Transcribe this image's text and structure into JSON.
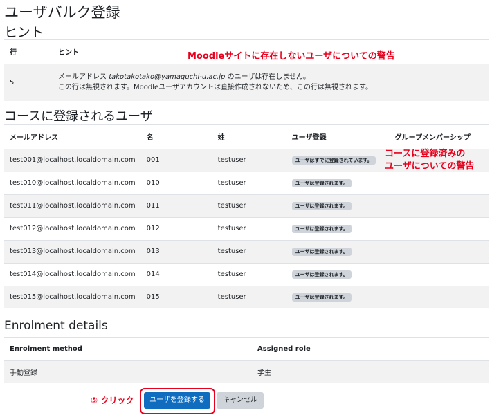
{
  "page": {
    "title": "ユーザバルク登録"
  },
  "hints": {
    "heading": "ヒント",
    "columns": [
      "行",
      "ヒント"
    ],
    "rows": [
      {
        "line": "5",
        "message_prefix": "メールアドレス ",
        "email": "takotakotako@yamaguchi-u.ac.jp",
        "message_suffix": " のユーザは存在しません。",
        "message_line2": "この行は無視されます。Moodleユーザアカウントは直接作成されないため、この行は無視されます。"
      }
    ]
  },
  "users": {
    "heading": "コースに登録されるユーザ",
    "columns": [
      "メールアドレス",
      "名",
      "姓",
      "ユーザ登録",
      "グループメンバーシップ"
    ],
    "rows": [
      {
        "email": "test001@localhost.localdomain.com",
        "firstname": "001",
        "lastname": "testuser",
        "status": "ユーザはすでに登録されています。",
        "group": ""
      },
      {
        "email": "test010@localhost.localdomain.com",
        "firstname": "010",
        "lastname": "testuser",
        "status": "ユーザは登録されます。",
        "group": ""
      },
      {
        "email": "test011@localhost.localdomain.com",
        "firstname": "011",
        "lastname": "testuser",
        "status": "ユーザは登録されます。",
        "group": ""
      },
      {
        "email": "test012@localhost.localdomain.com",
        "firstname": "012",
        "lastname": "testuser",
        "status": "ユーザは登録されます。",
        "group": ""
      },
      {
        "email": "test013@localhost.localdomain.com",
        "firstname": "013",
        "lastname": "testuser",
        "status": "ユーザは登録されます。",
        "group": ""
      },
      {
        "email": "test014@localhost.localdomain.com",
        "firstname": "014",
        "lastname": "testuser",
        "status": "ユーザは登録されます。",
        "group": ""
      },
      {
        "email": "test015@localhost.localdomain.com",
        "firstname": "015",
        "lastname": "testuser",
        "status": "ユーザは登録されます。",
        "group": ""
      }
    ]
  },
  "enrolment": {
    "heading": "Enrolment details",
    "columns": [
      "Enrolment method",
      "Assigned role"
    ],
    "rows": [
      {
        "method": "手動登録",
        "role": "学生"
      }
    ]
  },
  "annotations": {
    "site_warning": "Moodleサイトに存在しないユーザについての警告",
    "course_warning_line1": "コースに登録済みの",
    "course_warning_line2": "ユーザについての警告",
    "step_label": "⑤ クリック"
  },
  "buttons": {
    "submit": "ユーザを登録する",
    "cancel": "キャンセル"
  },
  "colors": {
    "primary": "#0f6cbf",
    "annotation_red": "#e8001c",
    "badge_gray": "#ced4da",
    "stripe": "#f2f2f2"
  }
}
